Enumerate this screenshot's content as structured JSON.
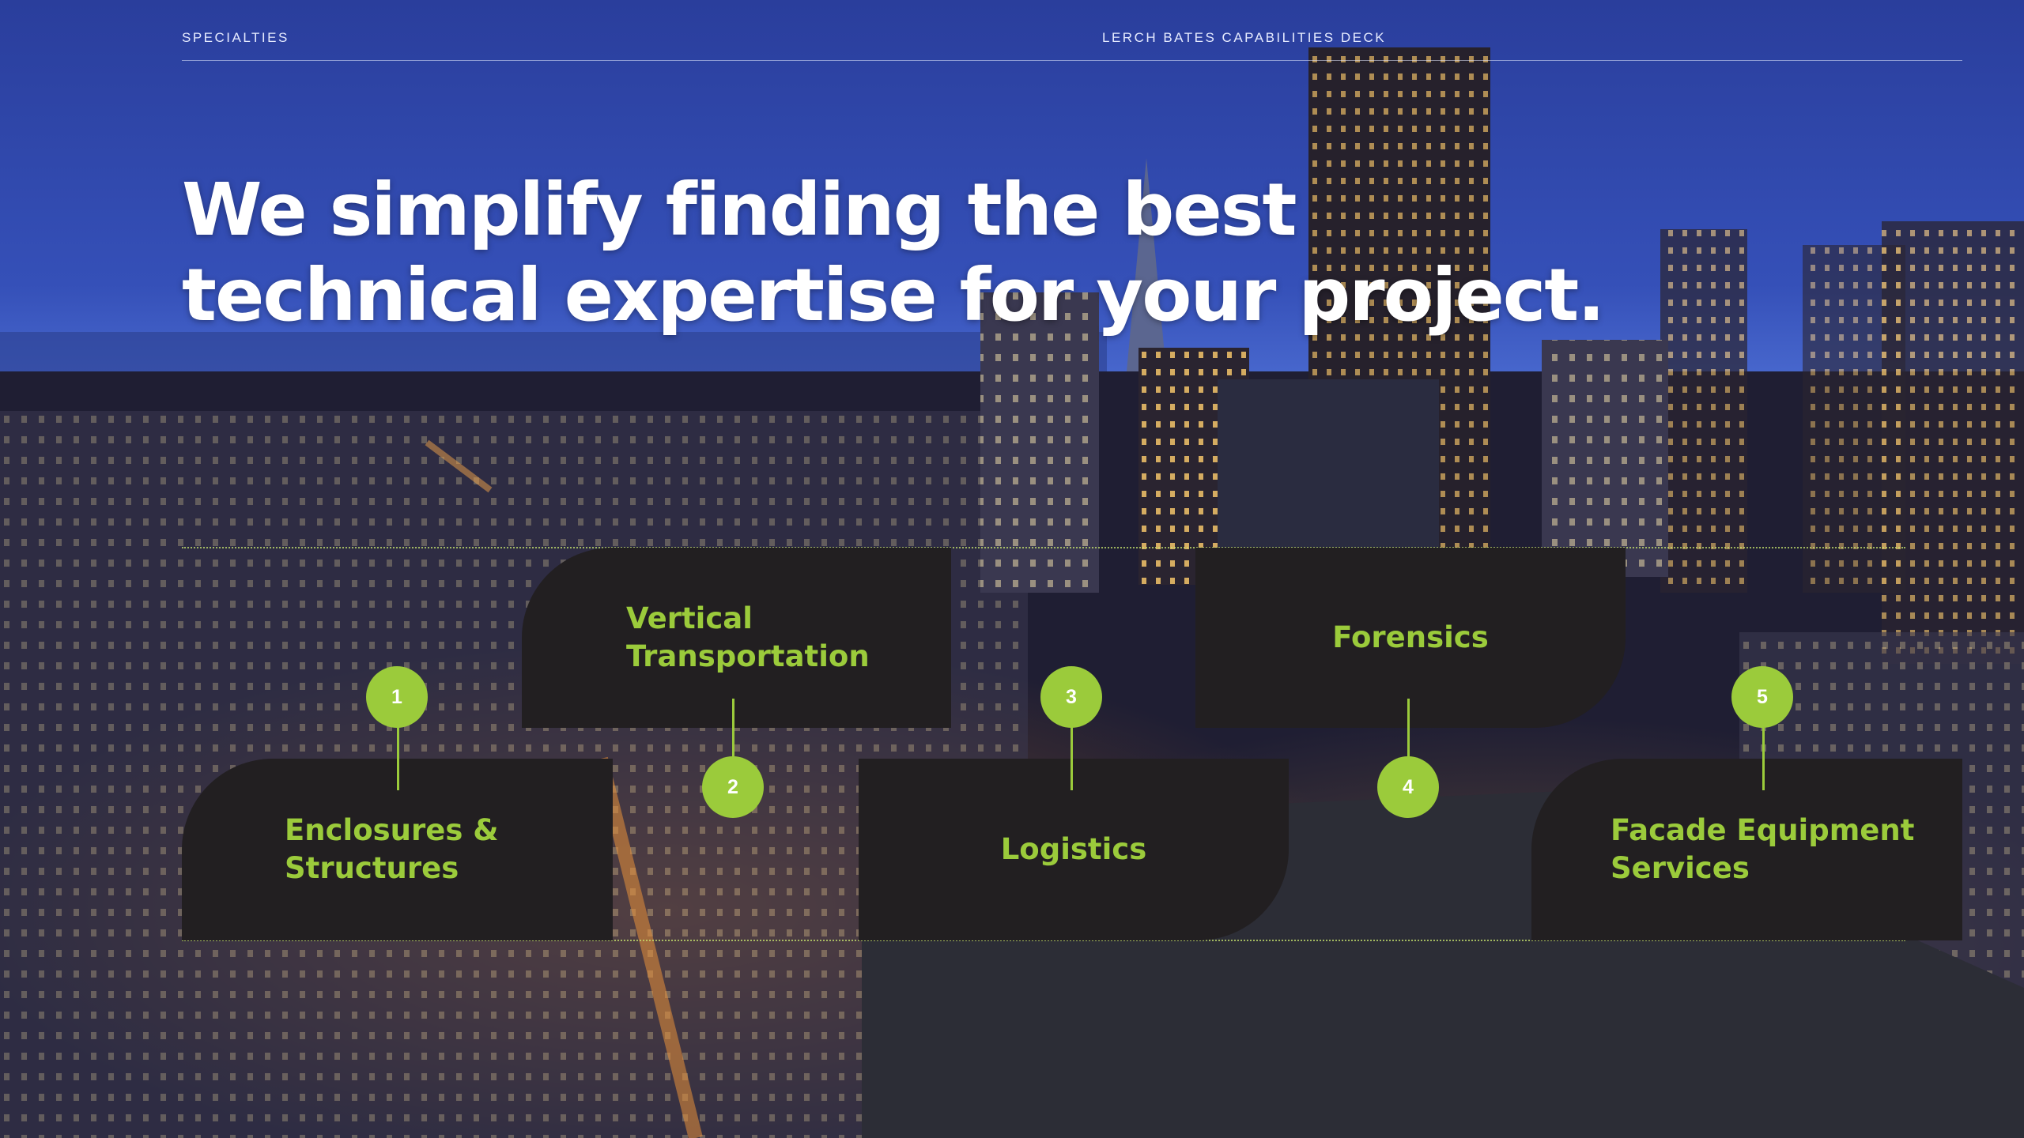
{
  "header": {
    "section": "SPECIALTIES",
    "deck_title": "LERCH BATES CAPABILITIES DECK"
  },
  "headline": {
    "line1": "We simplify finding the best",
    "line2": "technical expertise for your project."
  },
  "specialties": [
    {
      "number": "1",
      "label": "Enclosures &\nStructures"
    },
    {
      "number": "2",
      "label": "Vertical\nTransportation"
    },
    {
      "number": "3",
      "label": "Logistics"
    },
    {
      "number": "4",
      "label": "Forensics"
    },
    {
      "number": "5",
      "label": "Facade Equipment\nServices"
    }
  ],
  "colors": {
    "accent": "#9bcb3b",
    "card": "#221f21",
    "header_text": "#e6ebff"
  }
}
